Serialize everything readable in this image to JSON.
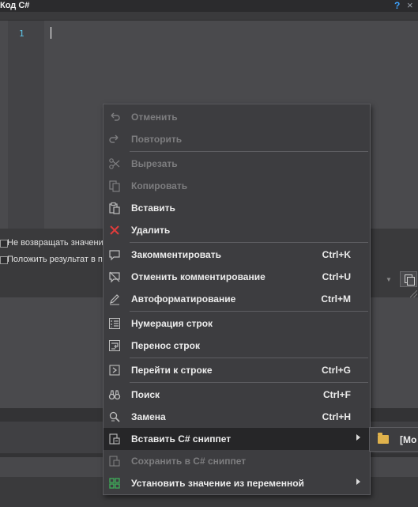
{
  "window": {
    "title": "Код C#",
    "help_glyph": "?",
    "close_glyph": "×"
  },
  "editor": {
    "line_number": "1"
  },
  "options": {
    "no_return_label": "Не возвращать значени",
    "put_result_label": "Положить результат в п"
  },
  "context_menu": {
    "items": [
      {
        "label": "Отменить",
        "shortcut": "",
        "icon": "undo-icon",
        "disabled": true
      },
      {
        "label": "Повторить",
        "shortcut": "",
        "icon": "redo-icon",
        "disabled": true
      },
      {
        "label": "Вырезать",
        "shortcut": "",
        "icon": "cut-icon",
        "disabled": true
      },
      {
        "label": "Копировать",
        "shortcut": "",
        "icon": "copy-icon",
        "disabled": true
      },
      {
        "label": "Вставить",
        "shortcut": "",
        "icon": "paste-icon",
        "disabled": false
      },
      {
        "label": "Удалить",
        "shortcut": "",
        "icon": "delete-icon",
        "disabled": false
      },
      {
        "label": "Закомментировать",
        "shortcut": "Ctrl+K",
        "icon": "comment-icon",
        "disabled": false
      },
      {
        "label": "Отменить комментирование",
        "shortcut": "Ctrl+U",
        "icon": "uncomment-icon",
        "disabled": false
      },
      {
        "label": "Автоформатирование",
        "shortcut": "Ctrl+M",
        "icon": "pencil-icon",
        "disabled": false
      },
      {
        "label": "Нумерация строк",
        "shortcut": "",
        "icon": "line-numbers-icon",
        "disabled": false
      },
      {
        "label": "Перенос строк",
        "shortcut": "",
        "icon": "word-wrap-icon",
        "disabled": false
      },
      {
        "label": "Перейти к строке",
        "shortcut": "Ctrl+G",
        "icon": "goto-line-icon",
        "disabled": false
      },
      {
        "label": "Поиск",
        "shortcut": "Ctrl+F",
        "icon": "binoculars-icon",
        "disabled": false
      },
      {
        "label": "Замена",
        "shortcut": "Ctrl+H",
        "icon": "replace-icon",
        "disabled": false
      },
      {
        "label": "Вставить C# сниппет",
        "shortcut": "",
        "icon": "insert-snippet-icon",
        "disabled": false,
        "has_submenu": true,
        "highlighted": true
      },
      {
        "label": "Сохранить в C# сниппет",
        "shortcut": "",
        "icon": "save-snippet-icon",
        "disabled": true
      },
      {
        "label": "Установить значение из переменной",
        "shortcut": "",
        "icon": "variable-grid-icon",
        "disabled": false,
        "has_submenu": true
      }
    ]
  },
  "submenu": {
    "label": "[Mo",
    "icon": "folder-icon"
  },
  "colors": {
    "accent_blue": "#3da3ff",
    "delete_red": "#e03c3c",
    "variable_green": "#3fae5a",
    "folder": "#e0b24c"
  }
}
